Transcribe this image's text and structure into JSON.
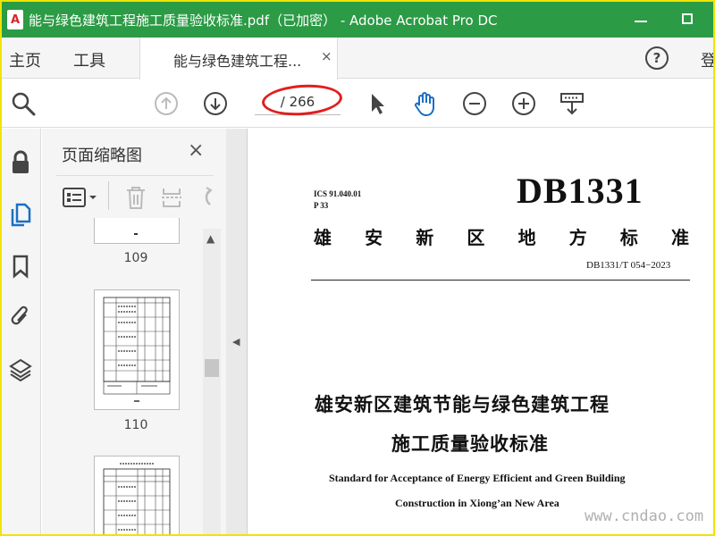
{
  "window": {
    "title": "能与绿色建筑工程施工质量验收标准.pdf（已加密） - Adobe Acrobat Pro DC",
    "logo": "pdf-logo-icon",
    "accent": "#2b9b45"
  },
  "menu": {
    "home": "主页",
    "tools": "工具",
    "tab_label": "能与绿色建筑工程...",
    "tab_close": "×",
    "signin": "登"
  },
  "toolbar": {
    "page_count": "/ 266",
    "annotation_color": "#e21e1e",
    "icons": [
      "search-icon",
      "page-up-icon",
      "page-down-icon",
      "select-pointer-icon",
      "hand-tool-icon",
      "zoom-out-icon",
      "zoom-in-icon",
      "scroll-mode-icon"
    ]
  },
  "rail": {
    "icons": [
      "lock-icon",
      "page-thumbnails-icon",
      "bookmark-icon",
      "attachment-icon",
      "layers-icon"
    ]
  },
  "thumbnails": {
    "title": "页面缩略图",
    "close": "×",
    "pages": [
      "109",
      "110"
    ]
  },
  "document": {
    "ics": "ICS 91.040.01",
    "ccs": "P 33",
    "code": "DB1331",
    "std_name_chars": [
      "雄",
      "安",
      "新",
      "区",
      "地",
      "方",
      "标",
      "准"
    ],
    "std_no": "DB1331/T 054−2023",
    "title_line1": "雄安新区建筑节能与绿色建筑工程",
    "title_line2": "施工质量验收标准",
    "en_line1": "Standard for Acceptance of Energy Efficient and Green Building",
    "en_line2": "Construction in Xiong’an New Area"
  },
  "watermark": "www.cndao.com"
}
